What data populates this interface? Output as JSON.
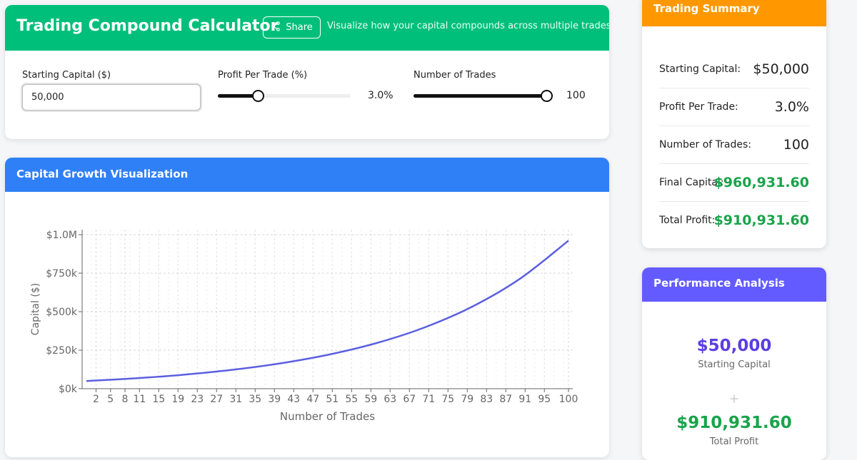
{
  "header": {
    "title": "Trading Compound Calculator",
    "share_label": "Share",
    "tagline": "Visualize how your capital compounds across multiple trades"
  },
  "inputs": {
    "capital_label": "Starting Capital ($)",
    "capital_value": "50,000",
    "profit_label": "Profit Per Trade (%)",
    "profit_display": "3.0%",
    "profit_fraction": 0.3,
    "trades_label": "Number of Trades",
    "trades_display": "100",
    "trades_fraction": 1.0
  },
  "chart_section": {
    "title": "Capital Growth Visualization"
  },
  "chart_data": {
    "type": "line",
    "xlabel": "Number of Trades",
    "ylabel": "Capital ($)",
    "x_ticks": [
      "2",
      "5",
      "8",
      "11",
      "15",
      "19",
      "23",
      "27",
      "31",
      "35",
      "39",
      "43",
      "47",
      "51",
      "55",
      "59",
      "63",
      "67",
      "71",
      "75",
      "79",
      "83",
      "87",
      "91",
      "95",
      "100"
    ],
    "y_ticks": [
      "$0k",
      "$250k",
      "$500k",
      "$750k",
      "$1.0M"
    ],
    "xlim": [
      0,
      100
    ],
    "ylim": [
      0,
      1000000
    ],
    "grid": true,
    "series": [
      {
        "color": "#5b5fe0",
        "x": [
          0,
          10,
          20,
          30,
          40,
          50,
          60,
          70,
          80,
          90,
          100
        ],
        "y": [
          50000,
          67196,
          90306,
          121363,
          163102,
          219195,
          294580,
          395891,
          532040,
          715011,
          960932
        ]
      }
    ]
  },
  "summary": {
    "title": "Trading Summary",
    "rows": [
      {
        "label": "Starting Capital:",
        "value": "$50,000"
      },
      {
        "label": "Profit Per Trade:",
        "value": "3.0%"
      },
      {
        "label": "Number of Trades:",
        "value": "100"
      },
      {
        "label": "Final Capital:",
        "value": "$960,931.60"
      },
      {
        "label": "Total Profit:",
        "value": "$910,931.60"
      }
    ]
  },
  "performance": {
    "title": "Performance Analysis",
    "starting_value": "$50,000",
    "starting_label": "Starting Capital",
    "plus": "+",
    "profit_value": "$910,931.60",
    "profit_label": "Total Profit"
  },
  "colors": {
    "header_green": "#00bf7a",
    "chart_blue": "#2f80f7",
    "summary_orange": "#ff9800",
    "performance_purple": "#635bff",
    "profit_green": "#1aa34a",
    "starting_purple": "#5b3fe0"
  }
}
